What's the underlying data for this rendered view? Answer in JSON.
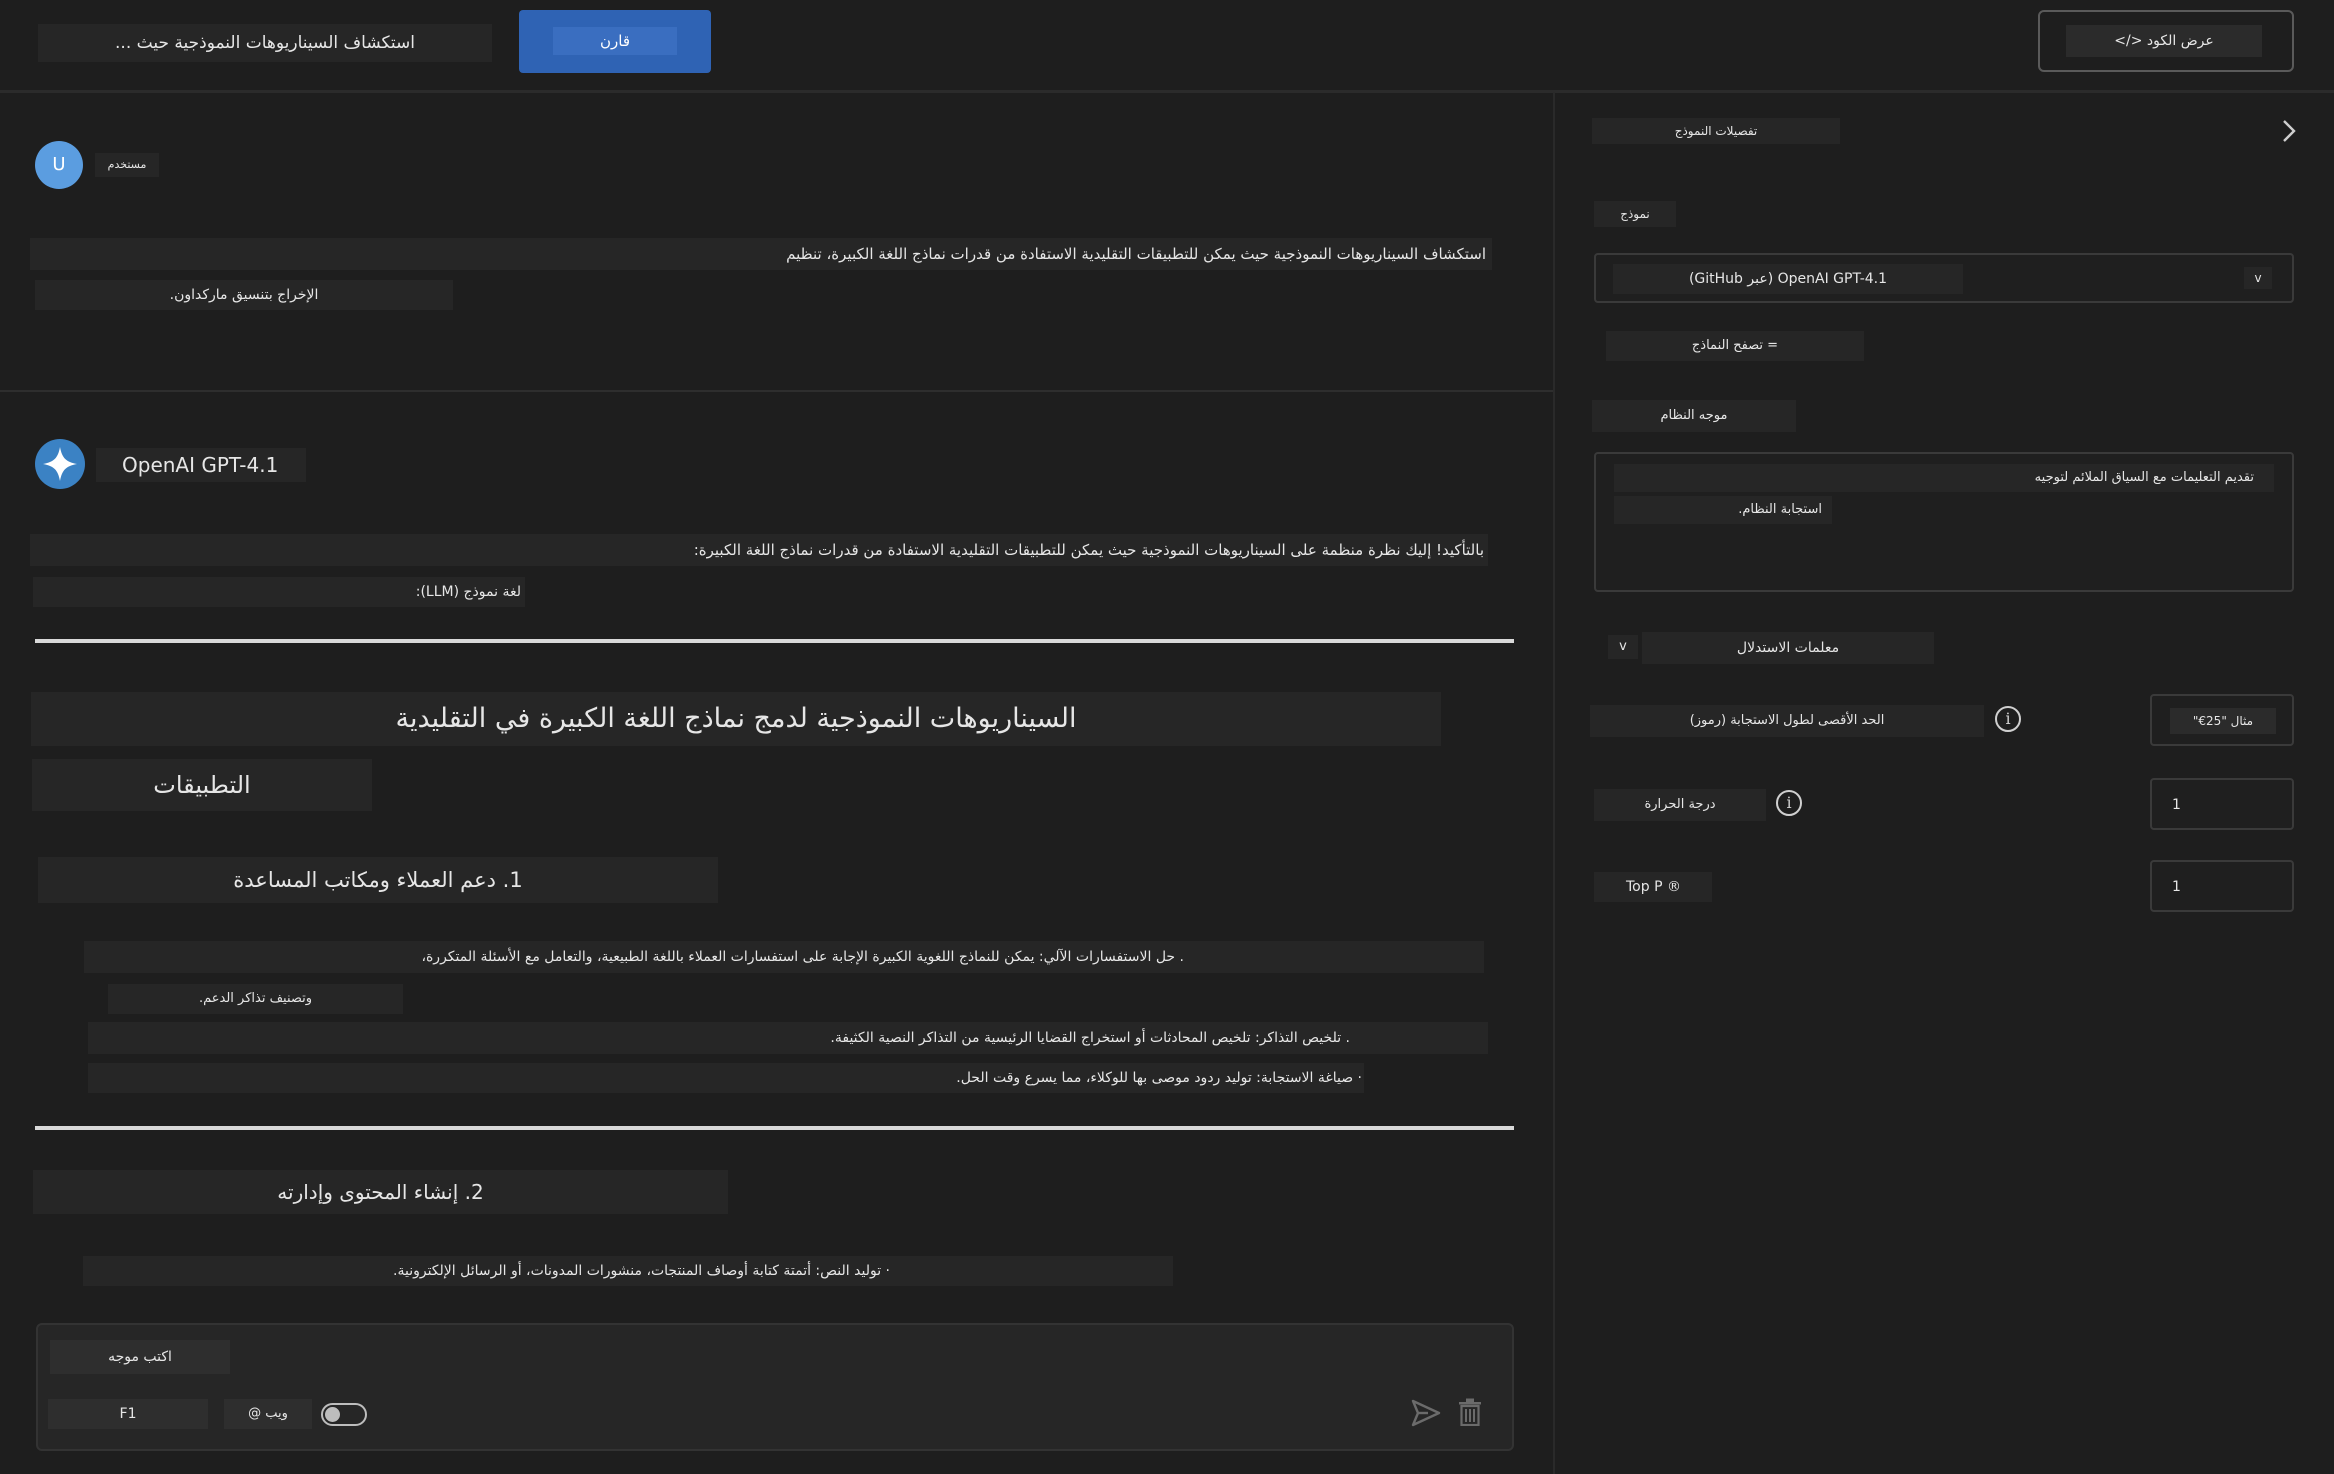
{
  "topbar": {
    "prompt_title": "استكشاف السيناريوهات النموذجية حيث ...",
    "compare_label": "قارن",
    "view_code_label": "</> عرض الكود"
  },
  "user_message": {
    "avatar_letter": "U",
    "role_label": "مستخدم",
    "line1": "استكشاف السيناريوهات النموذجية حيث يمكن للتطبيقات التقليدية الاستفادة من قدرات نماذج اللغة الكبيرة، تنظيم",
    "line2": "الإخراج بتنسيق ماركداون."
  },
  "assistant": {
    "model_name": "OpenAI GPT-4.1",
    "intro_line1": "بالتأكيد! إليك نظرة منظمة على السيناريوهات النموذجية حيث يمكن للتطبيقات التقليدية الاستفادة من قدرات نماذج اللغة الكبيرة:",
    "intro_line2": "لغة نموذج (LLM):",
    "heading_line1": "السيناريوهات النموذجية لدمج نماذج اللغة الكبيرة في التقليدية",
    "heading_line2": "التطبيقات",
    "section1_title": "1. دعم العملاء ومكاتب المساعدة",
    "section1_item1_line1": ". حل الاستفسارات الآلي: يمكن للنماذج اللغوية الكبيرة الإجابة على استفسارات العملاء باللغة الطبيعية، والتعامل مع الأسئلة المتكررة،",
    "section1_item1_line2": "وتصنيف تذاكر الدعم.",
    "section1_item2": ". تلخيص التذاكر: تلخيص المحادثات أو استخراج القضايا الرئيسية من التذاكر النصية الكثيفة.",
    "section1_item3": "· صياغة الاستجابة: توليد ردود موصى بها للوكلاء، مما يسرع وقت الحل.",
    "section2_title": "2. إنشاء المحتوى وإدارته",
    "section2_item1": "· توليد النص: أتمتة كتابة أوصاف المنتجات، منشورات المدونات، أو الرسائل الإلكترونية."
  },
  "composer": {
    "placeholder": "اكتب موجه",
    "shortcut_label": "F1",
    "web_label": "@ ويب",
    "web_toggle_on": false
  },
  "side_panel": {
    "title": "تفصيلات النموذج",
    "model_label": "نموذج",
    "model_value": "OpenAI GPT-4.1 (عبر GitHub)",
    "browse_models_label": "= تصفح النماذج",
    "system_prompt_label": "موجه النظام",
    "system_prompt_line1": "تقديم التعليمات مع السياق الملائم لتوجيه",
    "system_prompt_line2": "استجابة النظام.",
    "inference_label": "معلمات الاستدلال",
    "inference_toggle": "v",
    "max_tokens_label": "الحد الأقصى لطول الاستجابة (رموز)",
    "max_tokens_placeholder": "مثال \"25€\"",
    "temperature_label": "درجة الحرارة",
    "temperature_value": "1",
    "top_p_label": "Top P ®",
    "top_p_value": "1"
  },
  "colors": {
    "accent": "#2f63b4",
    "background": "#1e1e1e",
    "chip": "#262626"
  }
}
